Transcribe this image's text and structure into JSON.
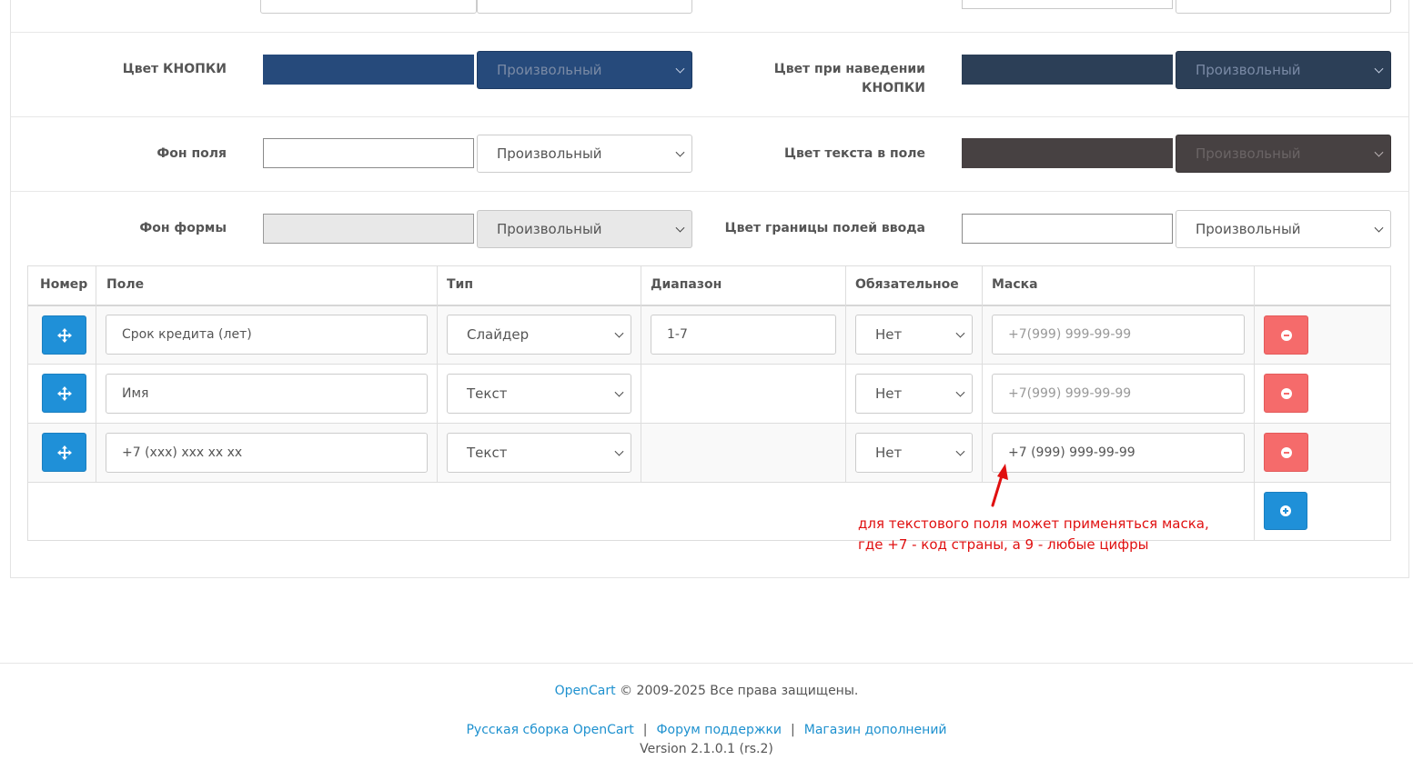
{
  "settings": {
    "button_color_label": "Цвет КНОПКИ",
    "button_hover_color_label": "Цвет при наведении КНОПКИ",
    "field_bg_label": "Фон поля",
    "field_text_color_label": "Цвет текста в поле",
    "form_bg_label": "Фон формы",
    "input_border_color_label": "Цвет границы полей ввода",
    "preset_value": "Произвольный",
    "colors": {
      "button": "#264a7b",
      "button_hover": "#2c3f57",
      "field_bg": "#ffffff",
      "field_text": "#474142",
      "form_bg": "#e8e8e8",
      "input_border": "#ffffff"
    }
  },
  "table": {
    "headers": [
      "Номер",
      "Поле",
      "Тип",
      "Диапазон",
      "Обязательное",
      "Маска"
    ],
    "rows": [
      {
        "field": "Срок кредита (лет)",
        "type": "Слайдер",
        "range": "1-7",
        "required": "Нет",
        "mask_placeholder": "+7(999) 999-99-99",
        "mask": ""
      },
      {
        "field": "Имя",
        "type": "Текст",
        "range": "",
        "required": "Нет",
        "mask_placeholder": "+7(999) 999-99-99",
        "mask": ""
      },
      {
        "field": "+7 (xxx) xxx xx xx",
        "type": "Текст",
        "range": "",
        "required": "Нет",
        "mask_placeholder": "",
        "mask": "+7 (999) 999-99-99"
      }
    ]
  },
  "annotation": {
    "line1": "для текстового поля может применяться маска,",
    "line2": "где +7 - код страны, а 9 - любые цифры"
  },
  "footer": {
    "brand": "OpenCart",
    "copyright": "© 2009-2025 Все права защищены.",
    "link1": "Русская сборка OpenCart",
    "link2": "Форум поддержки",
    "link3": "Магазин дополнений",
    "version": "Version 2.1.0.1 (rs.2)"
  },
  "icons": {
    "move": "move-arrows-icon",
    "remove": "minus-circle-icon",
    "add": "plus-circle-icon"
  }
}
